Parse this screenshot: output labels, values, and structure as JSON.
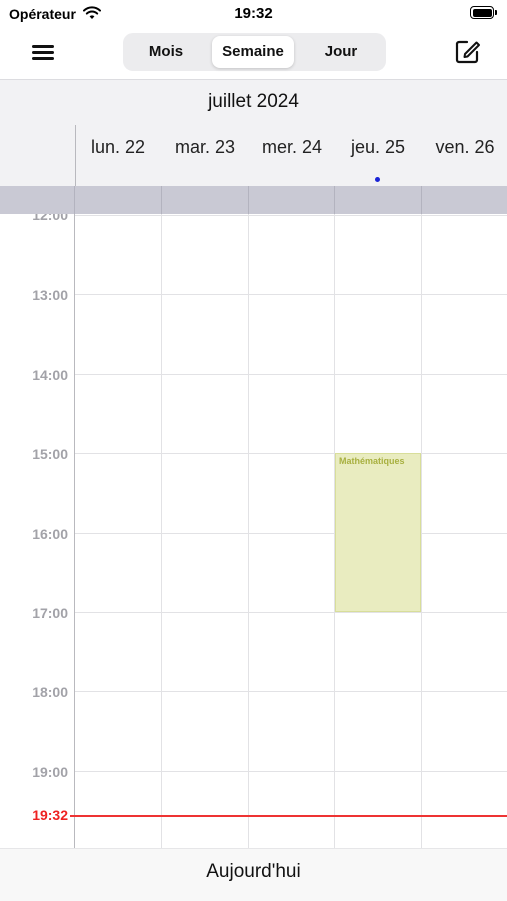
{
  "status_bar": {
    "carrier": "Opérateur",
    "time": "19:32"
  },
  "nav": {
    "segments": [
      "Mois",
      "Semaine",
      "Jour"
    ],
    "selected": "Semaine"
  },
  "month_title": "juillet 2024",
  "days": [
    "lun. 22",
    "mar. 23",
    "mer. 24",
    "jeu. 25",
    "ven. 26"
  ],
  "today_index": 3,
  "hours": [
    "12:00",
    "13:00",
    "14:00",
    "15:00",
    "16:00",
    "17:00",
    "18:00",
    "19:00"
  ],
  "now_label": "19:32",
  "events": [
    {
      "title": "Mathématiques",
      "day_index": 3,
      "start": "15:00",
      "end": "17:00",
      "color": "#e9ecc0",
      "text_color": "#a8b040"
    }
  ],
  "bottom": {
    "today_label": "Aujourd'hui"
  },
  "colors": {
    "now_line": "#e33333",
    "today_dot": "#1a24d6"
  }
}
